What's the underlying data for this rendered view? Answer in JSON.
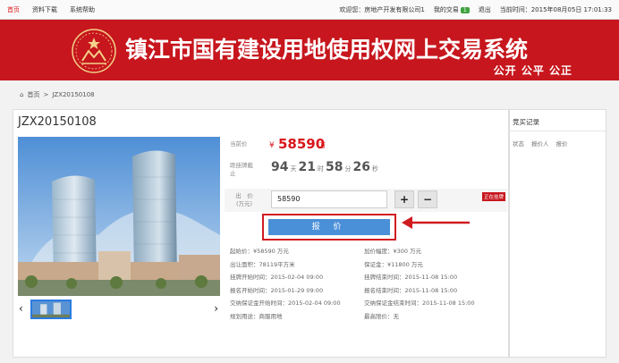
{
  "topbar": {
    "nav": [
      "首页",
      "资料下载",
      "系统帮助"
    ],
    "welcome": "欢迎您：房地产开发有限公司1",
    "my_trade": "我的交易",
    "my_trade_count": "1",
    "logout": "退出",
    "current_time": "当前时间：2015年08月05日 17:01:33"
  },
  "banner": {
    "title": "镇江市国有建设用地使用权网上交易系统",
    "slogan": "公开 公平 公正"
  },
  "breadcrumb": {
    "home": "首页",
    "sep": ">",
    "current": "JZX20150108"
  },
  "lot": {
    "code": "JZX20150108",
    "price_label": "当前价",
    "price_yen": "¥",
    "price_value": "58590",
    "price_unit": "万",
    "countdown_label": "距挂牌截止",
    "days": "94",
    "hours": "21",
    "minutes": "58",
    "seconds": "26",
    "day_unit": "天",
    "hour_unit": "时",
    "minute_unit": "分",
    "second_unit": "秒",
    "bid_label": "出　价\n(万元)",
    "bid_value": "58590",
    "plus": "+",
    "minus": "−",
    "status_tag": "正在挂牌",
    "bid_button": "报 价"
  },
  "details": [
    [
      "起始价：¥58590 万元",
      "加价幅度：¥300 万元"
    ],
    [
      "出让面积：78119平方米",
      "保证金：¥11800 万元"
    ],
    [
      "挂牌开始时间：2015-02-04 09:00",
      "挂牌结束时间：2015-11-08 15:00"
    ],
    [
      "报名开始时间：2015-01-29 09:00",
      "报名结束时间：2015-11-08 15:00"
    ],
    [
      "交纳保证金开始时间：2015-02-04 09:00",
      "交纳保证金结束时间：2015-11-08 15:00"
    ],
    [
      "规划用途：商服用地",
      "最高限价：无"
    ]
  ],
  "records": {
    "title": "竞买记录",
    "cols": [
      "状态",
      "报价人",
      "报价"
    ]
  },
  "colors": {
    "brand_red": "#c7161d",
    "bid_blue": "#4a90d9"
  }
}
